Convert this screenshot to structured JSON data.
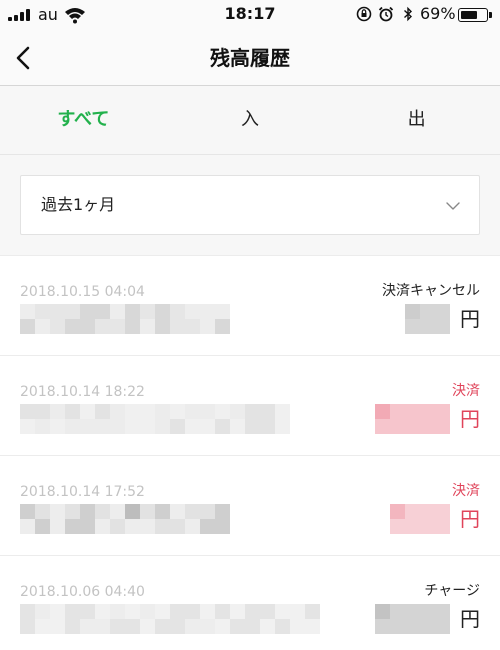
{
  "status_bar": {
    "carrier": "au",
    "time": "18:17",
    "battery_percent_label": "69%",
    "battery_level": 0.69,
    "icons": [
      "signal-icon",
      "wifi-icon",
      "orientation-lock-icon",
      "alarm-icon",
      "bluetooth-icon",
      "battery-icon"
    ]
  },
  "nav": {
    "title": "残高履歴",
    "back_icon": "chevron-left-icon"
  },
  "tabs": [
    {
      "label": "すべて",
      "active": true
    },
    {
      "label": "入",
      "active": false
    },
    {
      "label": "出",
      "active": false
    }
  ],
  "filter": {
    "selected": "過去1ヶ月",
    "icon": "chevron-down-icon"
  },
  "colors": {
    "accent_green": "#22b14c",
    "payment_red": "#e0445a",
    "date_gray": "#c3c3c3"
  },
  "history": [
    {
      "date": "2018.10.15 04:04",
      "type": "決済キャンセル",
      "type_color": "default",
      "currency": "円"
    },
    {
      "date": "2018.10.14 18:22",
      "type": "決済",
      "type_color": "red",
      "currency": "円"
    },
    {
      "date": "2018.10.14 17:52",
      "type": "決済",
      "type_color": "red",
      "currency": "円"
    },
    {
      "date": "2018.10.06 04:40",
      "type": "チャージ",
      "type_color": "default",
      "currency": "円"
    }
  ]
}
